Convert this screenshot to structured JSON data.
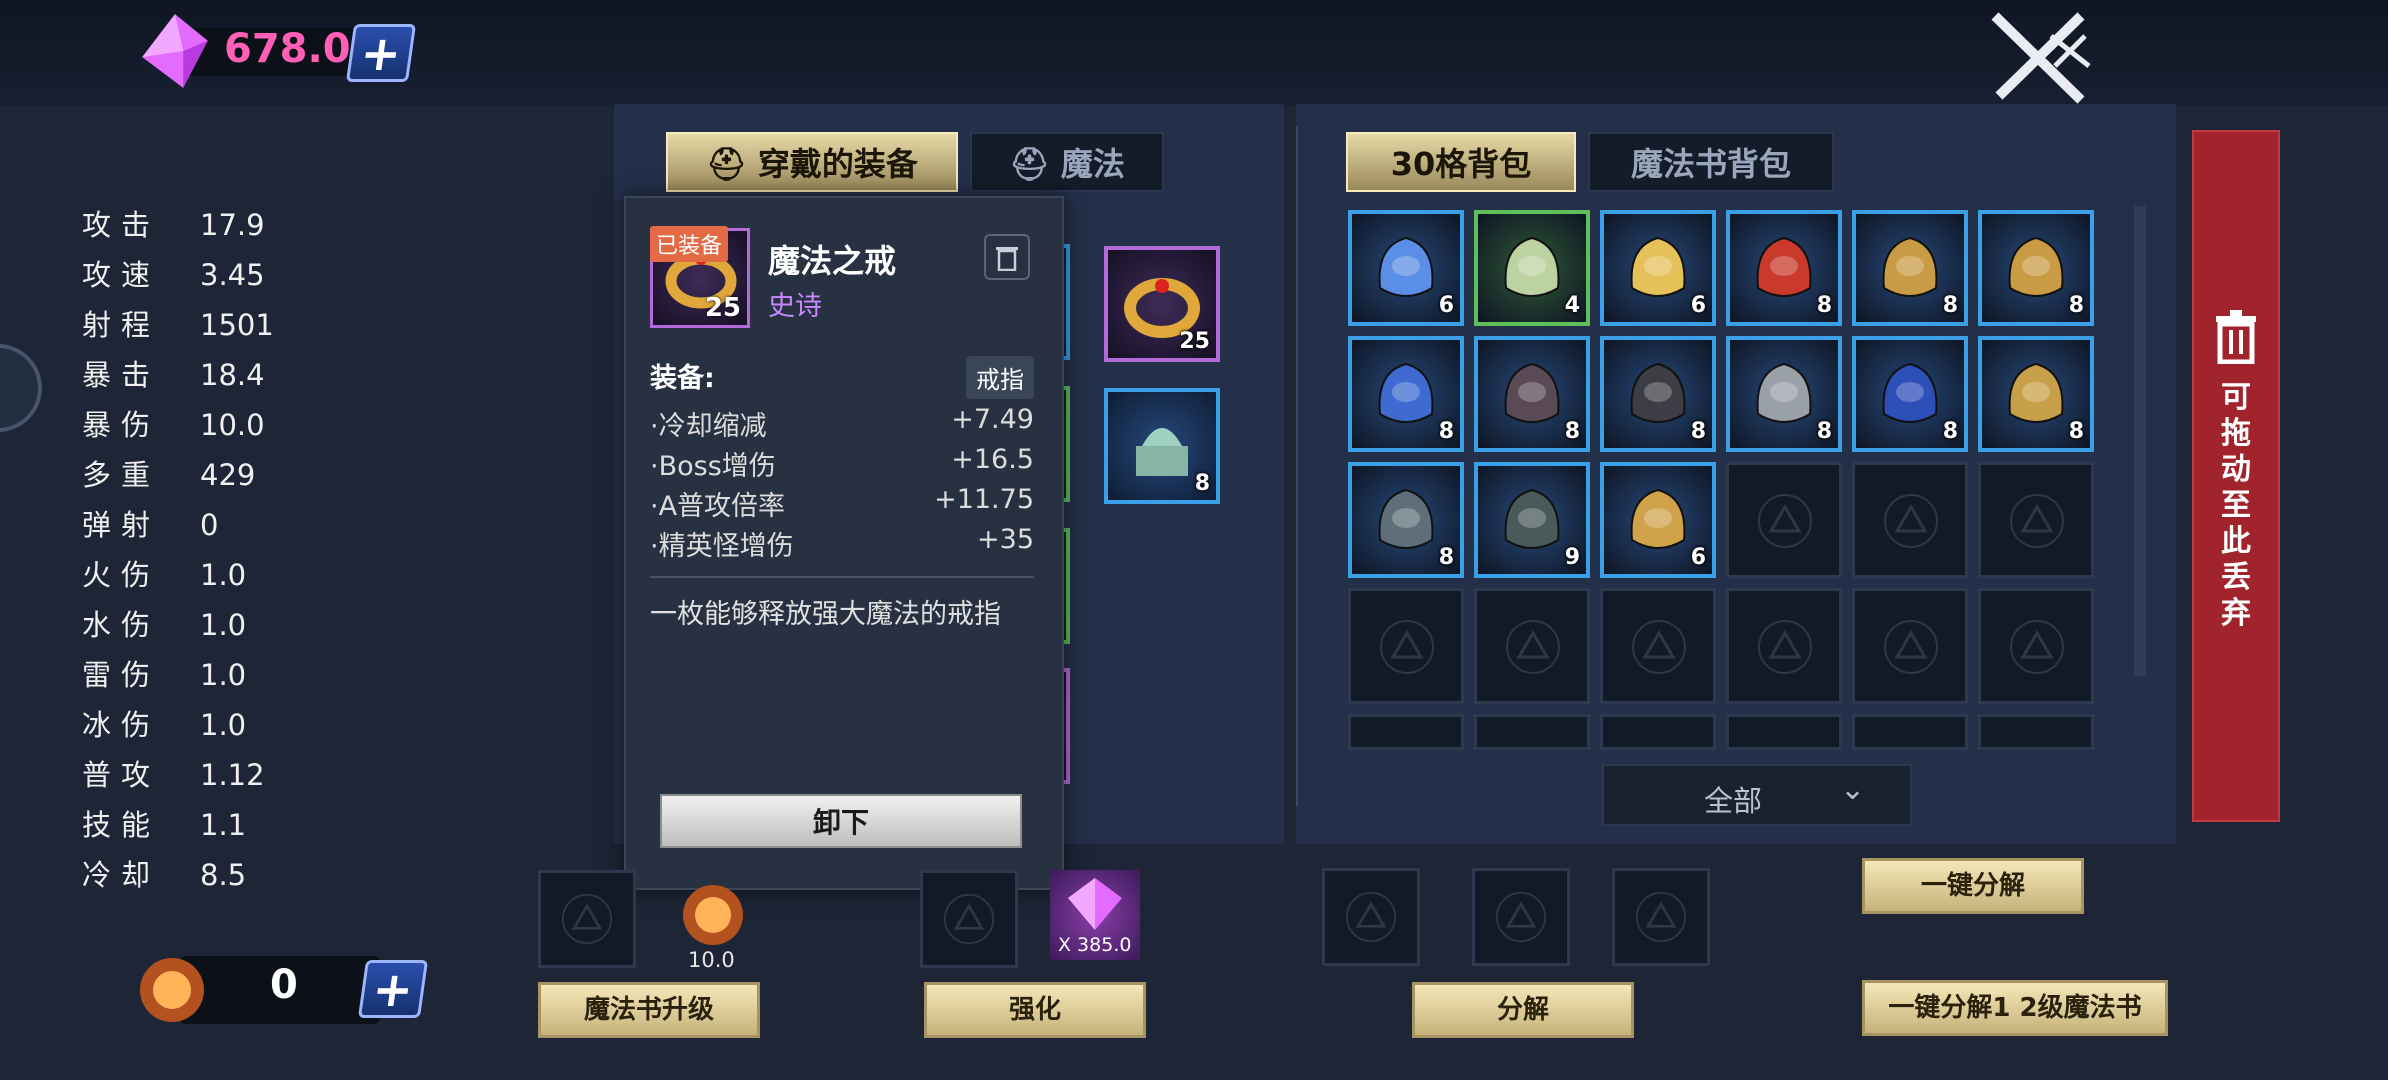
{
  "currency": {
    "gems": "678.0",
    "essence": "0"
  },
  "stats": [
    {
      "label": "攻击",
      "value": "17.9"
    },
    {
      "label": "攻速",
      "value": "3.45"
    },
    {
      "label": "射程",
      "value": "1501"
    },
    {
      "label": "暴击",
      "value": "18.4"
    },
    {
      "label": "暴伤",
      "value": "10.0"
    },
    {
      "label": "多重",
      "value": "429"
    },
    {
      "label": "弹射",
      "value": "0"
    },
    {
      "label": "火伤",
      "value": "1.0"
    },
    {
      "label": "水伤",
      "value": "1.0"
    },
    {
      "label": "雷伤",
      "value": "1.0"
    },
    {
      "label": "冰伤",
      "value": "1.0"
    },
    {
      "label": "普攻",
      "value": "1.12"
    },
    {
      "label": "技能",
      "value": "1.1"
    },
    {
      "label": "冷却",
      "value": "8.5"
    }
  ],
  "equip_tabs": [
    "穿戴的装备",
    "魔法"
  ],
  "bag_tabs": [
    "30格背包",
    "魔法书背包"
  ],
  "equipped_visible": [
    {
      "count": "25",
      "icon": "gold-ring",
      "rarity": "epic"
    },
    {
      "count": "8",
      "icon": "jade-seal",
      "rarity": "rare"
    }
  ],
  "bag_items": [
    {
      "count": "6",
      "icon": "blue-helmet",
      "rarity": "rare"
    },
    {
      "count": "4",
      "icon": "ghost-cloak",
      "rarity": "uncommon"
    },
    {
      "count": "6",
      "icon": "gold-dragon-ring",
      "rarity": "rare"
    },
    {
      "count": "8",
      "icon": "red-armor",
      "rarity": "rare"
    },
    {
      "count": "8",
      "icon": "gold-ring",
      "rarity": "rare"
    },
    {
      "count": "8",
      "icon": "gold-ring",
      "rarity": "rare"
    },
    {
      "count": "8",
      "icon": "blue-whip",
      "rarity": "rare"
    },
    {
      "count": "8",
      "icon": "dark-helmet",
      "rarity": "rare"
    },
    {
      "count": "8",
      "icon": "dark-armor",
      "rarity": "rare"
    },
    {
      "count": "8",
      "icon": "silver-crown",
      "rarity": "rare"
    },
    {
      "count": "8",
      "icon": "blue-boots",
      "rarity": "rare"
    },
    {
      "count": "8",
      "icon": "gold-helmet",
      "rarity": "rare"
    },
    {
      "count": "8",
      "icon": "gem-ring",
      "rarity": "rare"
    },
    {
      "count": "9",
      "icon": "spiked-armor",
      "rarity": "rare"
    },
    {
      "count": "6",
      "icon": "gold-crown-ring",
      "rarity": "rare"
    }
  ],
  "tooltip": {
    "tag": "已装备",
    "name": "魔法之戒",
    "rarity": "史诗",
    "count": "25",
    "section": "装备:",
    "type": "戒指",
    "stats": [
      {
        "label": "·冷却缩减",
        "value": "+7.49"
      },
      {
        "label": "·Boss增伤",
        "value": "+16.5"
      },
      {
        "label": "·A普攻倍率",
        "value": "+11.75"
      },
      {
        "label": "·精英怪增伤",
        "value": "+35"
      }
    ],
    "description": "一枚能够释放强大魔法的戒指",
    "unequip_label": "卸下"
  },
  "discard_label": "可拖动至此丢弃",
  "filter_label": "全部",
  "bottom": {
    "essence_cost": "10.0",
    "gem_cost": "X 385.0",
    "upgrade_label": "魔法书升级",
    "enhance_label": "强化",
    "decompose_label": "分解",
    "auto_decompose_label": "一键分解",
    "auto_decompose_lv_label": "一键分解1 2级魔法书"
  },
  "colors": {
    "gold_tab": "#d8c78f",
    "discard_red": "#a1232c",
    "rare_border": "#3aa1e8",
    "epic_border": "#b46ad8",
    "gem_text": "#ff5fb5"
  }
}
